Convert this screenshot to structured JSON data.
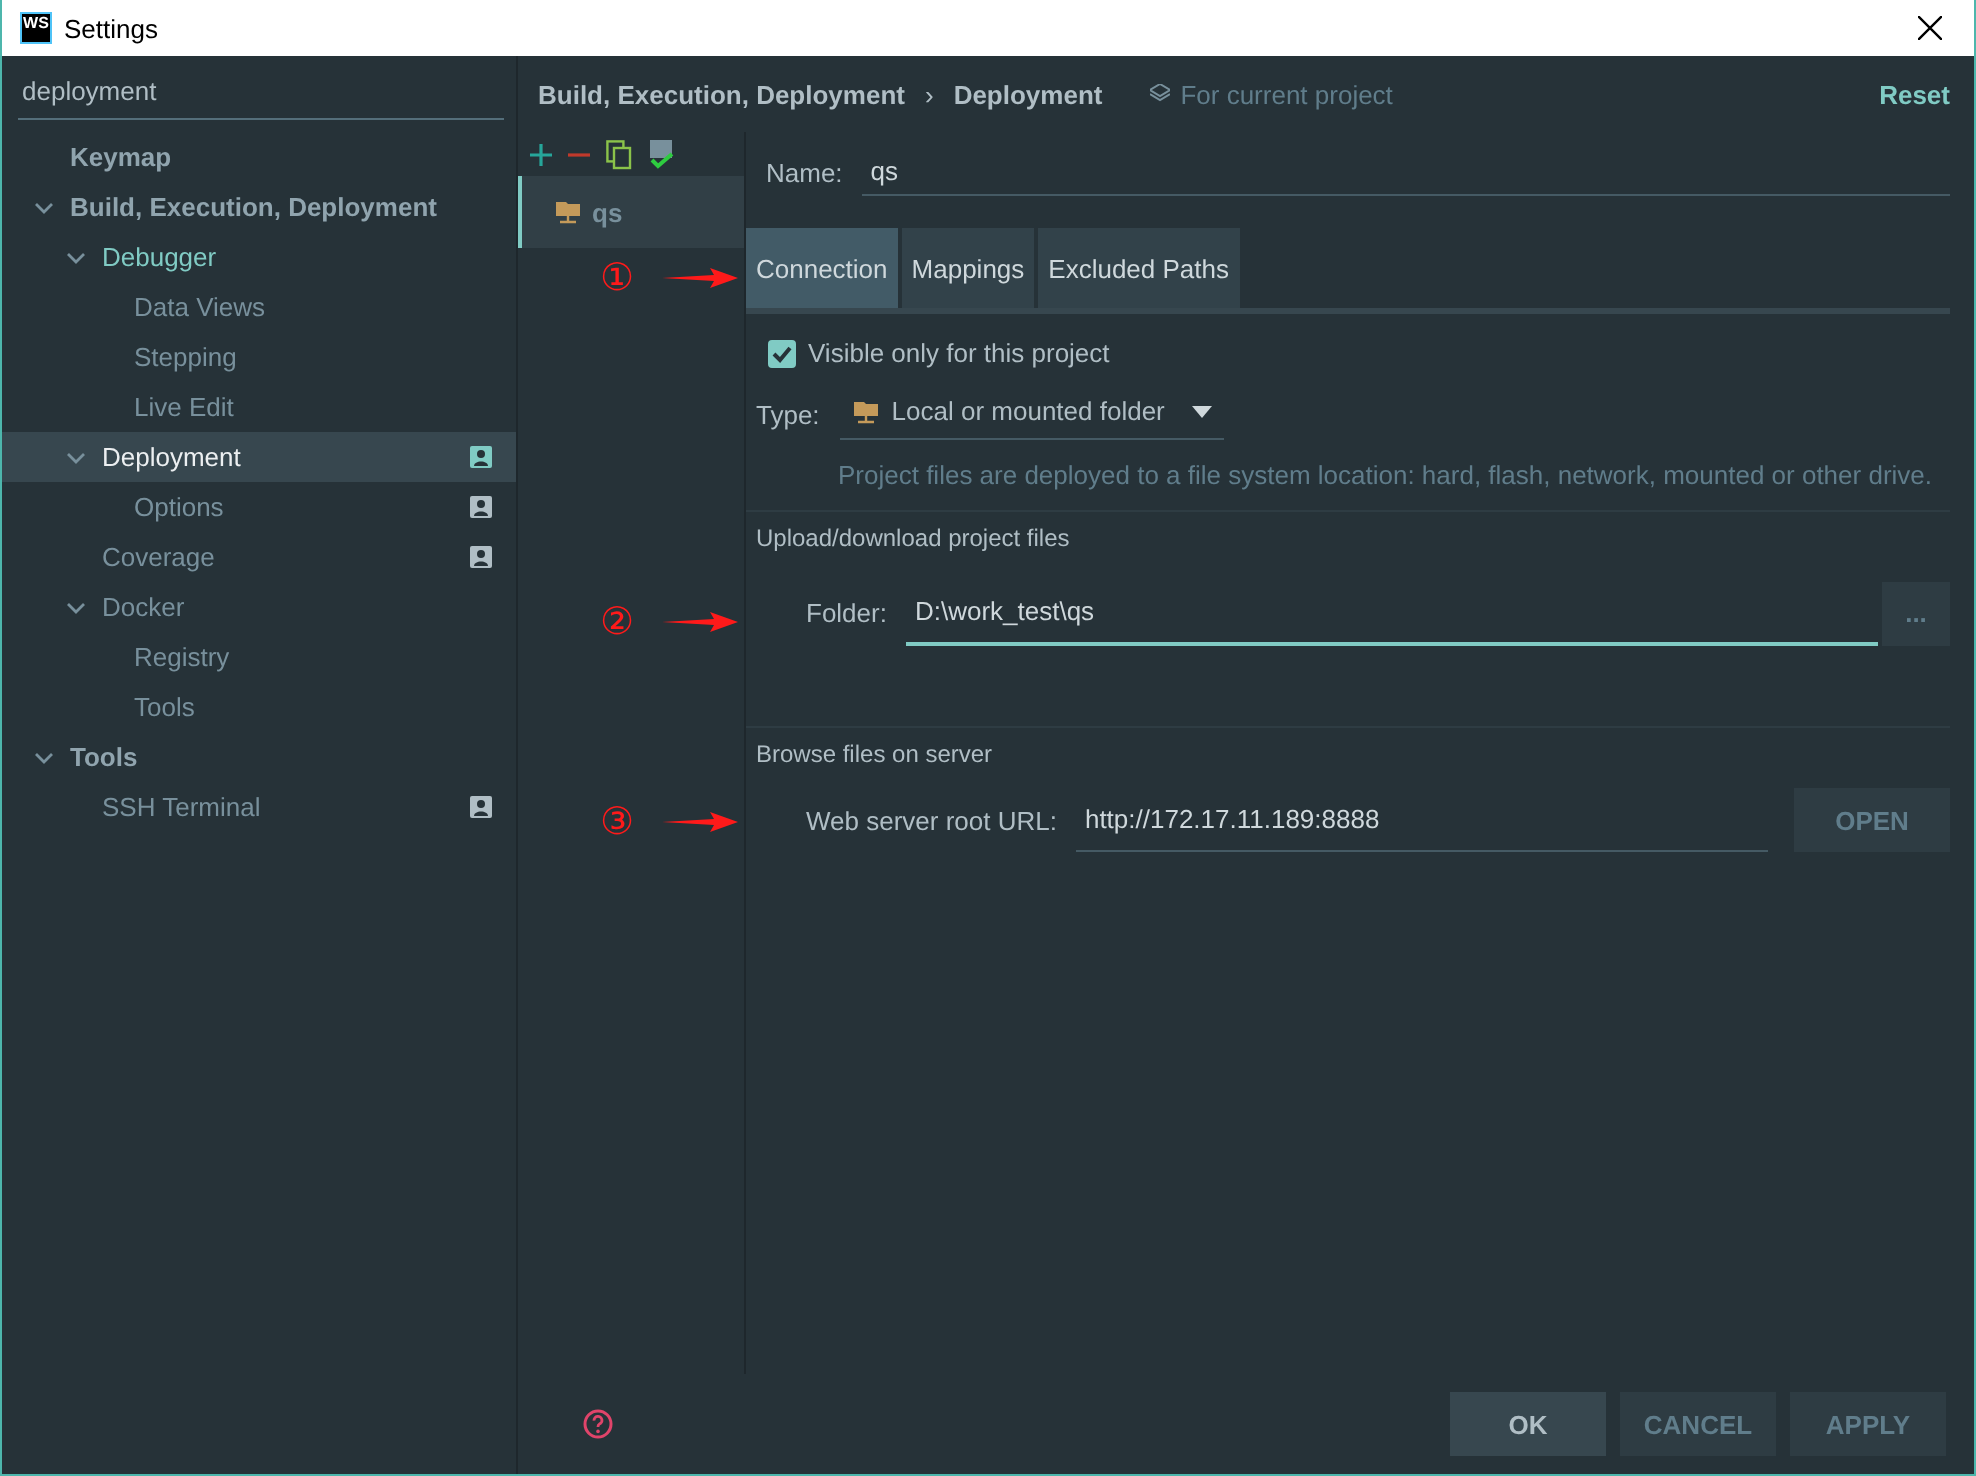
{
  "window": {
    "title": "Settings",
    "app_badge": "WS"
  },
  "search": {
    "value": "deployment"
  },
  "tree": [
    {
      "label": "Keymap",
      "bold": true,
      "selected": false
    },
    {
      "label": "Build, Execution, Deployment",
      "bold": true,
      "selected": false,
      "expanded": true,
      "children": [
        {
          "label": "Debugger",
          "modified": true,
          "selected": false,
          "expanded": true,
          "children": [
            {
              "label": "Data Views",
              "selected": false
            },
            {
              "label": "Stepping",
              "selected": false
            },
            {
              "label": "Live Edit",
              "selected": false
            }
          ]
        },
        {
          "label": "Deployment",
          "selected": true,
          "project_level": true,
          "expanded": true,
          "children": [
            {
              "label": "Options",
              "selected": false,
              "project_level": true
            }
          ]
        },
        {
          "label": "Coverage",
          "selected": false,
          "project_level": true
        },
        {
          "label": "Docker",
          "selected": false,
          "expanded": true,
          "children": [
            {
              "label": "Registry",
              "selected": false
            },
            {
              "label": "Tools",
              "selected": false
            }
          ]
        }
      ]
    },
    {
      "label": "Tools",
      "bold": true,
      "selected": false,
      "expanded": true,
      "children": [
        {
          "label": "SSH Terminal",
          "selected": false,
          "project_level": true
        }
      ]
    }
  ],
  "breadcrumb": {
    "parent": "Build, Execution, Deployment",
    "separator": "›",
    "current": "Deployment",
    "scope": "For current project",
    "reset": "Reset"
  },
  "servers": [
    {
      "name": "qs",
      "selected": true
    }
  ],
  "name_field": {
    "label": "Name:",
    "value": "qs"
  },
  "tabs": [
    {
      "label": "Connection",
      "selected": true
    },
    {
      "label": "Mappings",
      "selected": false
    },
    {
      "label": "Excluded Paths",
      "selected": false
    }
  ],
  "visible_only": {
    "label": "Visible only for this project",
    "checked": true
  },
  "type": {
    "label": "Type:",
    "value": "Local or mounted folder",
    "description": "Project files are deployed to a file system location: hard, flash, network, mounted or other drive."
  },
  "upload_section": {
    "title": "Upload/download project files",
    "folder_label": "Folder:",
    "folder_value": "D:\\work_test\\qs",
    "focused": true,
    "browse": "..."
  },
  "browse_section": {
    "title": "Browse files on server",
    "url_label": "Web server root URL:",
    "url_value": "http://172.17.11.189:8888",
    "open": "OPEN"
  },
  "annotations": [
    "①",
    "②",
    "③"
  ],
  "buttons": [
    {
      "label": "OK",
      "default": true
    },
    {
      "label": "CANCEL",
      "default": false
    },
    {
      "label": "APPLY",
      "default": false
    }
  ]
}
